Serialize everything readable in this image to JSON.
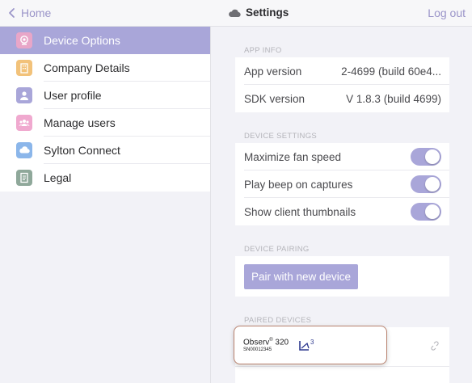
{
  "topbar": {
    "back_label": "Home",
    "title": "Settings",
    "logout_label": "Log out"
  },
  "sidebar": {
    "items": [
      {
        "label": "Device Options",
        "icon": "camera-icon",
        "color": "#e8a6c8",
        "active": true
      },
      {
        "label": "Company Details",
        "icon": "building-icon",
        "color": "#f2c27a",
        "active": false
      },
      {
        "label": "User profile",
        "icon": "person-icon",
        "color": "#a9a6d9",
        "active": false
      },
      {
        "label": "Manage users",
        "icon": "group-icon",
        "color": "#f0a9cf",
        "active": false
      },
      {
        "label": "Sylton Connect",
        "icon": "cloud-icon",
        "color": "#8bb6ea",
        "active": false
      },
      {
        "label": "Legal",
        "icon": "document-icon",
        "color": "#8fa89a",
        "active": false
      }
    ]
  },
  "app_info": {
    "header": "APP INFO",
    "rows": [
      {
        "label": "App version",
        "value": "2-4699 (build 60e4..."
      },
      {
        "label": "SDK version",
        "value": "V 1.8.3 (build 4699)"
      }
    ]
  },
  "device_settings": {
    "header": "DEVICE SETTINGS",
    "rows": [
      {
        "label": "Maximize fan speed",
        "on": true
      },
      {
        "label": "Play beep on captures",
        "on": true
      },
      {
        "label": "Show client thumbnails",
        "on": true
      }
    ]
  },
  "device_pairing": {
    "header": "DEVICE PAIRING",
    "button_label": "Pair with new device"
  },
  "paired_devices": {
    "header": "PAIRED DEVICES",
    "device": {
      "name": "Observ",
      "reg_mark": "®",
      "model": " 320",
      "serial": "SN00012345",
      "logo": "observ-logo-icon",
      "action_icon": "unlink-icon"
    }
  },
  "colors": {
    "accent": "#a9a6d9",
    "link": "#9b95c9",
    "card_border": "#b9826f"
  }
}
